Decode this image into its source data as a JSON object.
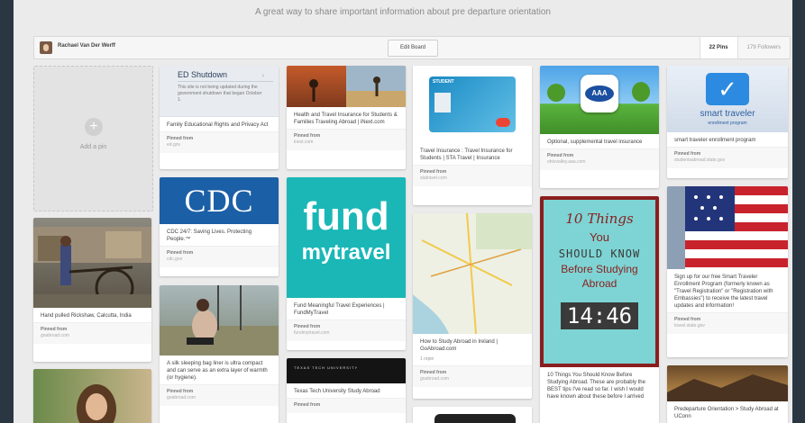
{
  "board": {
    "description": "A great way to share important information about pre departure orientation",
    "owner": "Rachael Van Der Werff",
    "edit_label": "Edit Board",
    "pins_label": "22 Pins",
    "followers_label": "179 Followers"
  },
  "add_pin_label": "Add a pin",
  "pinned_from": "Pinned from",
  "pins": {
    "ed": {
      "img_title": "ED Shutdown",
      "img_text": "This site is not being updated during the government shutdown that began October 1.",
      "caption": "Family Educational Rights and Privacy Act",
      "source": "ed.gov"
    },
    "cdc": {
      "img_text": "CDC",
      "caption": "CDC 24/7: Saving Lives. Protecting People.™",
      "source": "cdc.gov"
    },
    "bag": {
      "caption": "A silk sleeping bag liner is ultra compact and can serve as an extra layer of warmth (or hygiene).",
      "source": "goabroad.com"
    },
    "iext": {
      "caption": "Health and Travel Insurance for Students & Families Traveling Abroad | iNext.com",
      "source": "inext.com"
    },
    "fund": {
      "img_line1": "fund",
      "img_line2": "mytravel",
      "caption": "Fund Meaningful Travel Experiences | FundMyTravel",
      "source": "fundmytravel.com"
    },
    "ttu": {
      "img_text": "TEXAS TECH UNIVERSITY",
      "caption": "Texas Tech University Study Abroad",
      "source": ""
    },
    "sta": {
      "card_text": "STUDENT",
      "caption": "Travel Insurance : Travel Insurance for Students | STA Travel | Insurance",
      "source": "statravel.com"
    },
    "map": {
      "caption": "How to Study Abroad in Ireland | GoAbroad.com",
      "repin": "1 repin",
      "source": "goabroad.com"
    },
    "aaa": {
      "img_text": "AAA",
      "caption": "Optional, supplemental travel insurance",
      "source": "ohiovalley.aaa.com"
    },
    "tenthings": {
      "l1": "10 Things",
      "l2": "You",
      "l3": "SHOULD KNOW",
      "l4": "Before Studying",
      "l5": "Abroad",
      "timer": "14:46",
      "caption": "10 Things You Should Know Before Studying Abroad. These are probably the BEST tips I've read so far. I wish I would have known about these before I arrived",
      "source": ""
    },
    "steplogo": {
      "img_line1": "smart traveler",
      "img_line2": "enrollment program",
      "caption": "smart traveler enrollment program",
      "source": "studentsabroad.state.gov"
    },
    "flag": {
      "caption": "Sign up for our free Smart Traveler Enrollment Program (formerly known as \"Travel Registration\" or \"Registration with Embassies\") to receive the latest travel updates and information!",
      "source": "travel.state.gov"
    },
    "rick": {
      "caption": "Hand pulled Rickshaw, Calcutta, India",
      "source": "goabroad.com"
    },
    "predep": {
      "caption": "Predeparture Orientation > Study Abroad at UConn"
    }
  },
  "colors": {
    "cdc_blue": "#1b5fa7",
    "fund_teal": "#1bb7b7",
    "frame_bg": "#2a3743",
    "ten_red": "#8a1e1e"
  }
}
